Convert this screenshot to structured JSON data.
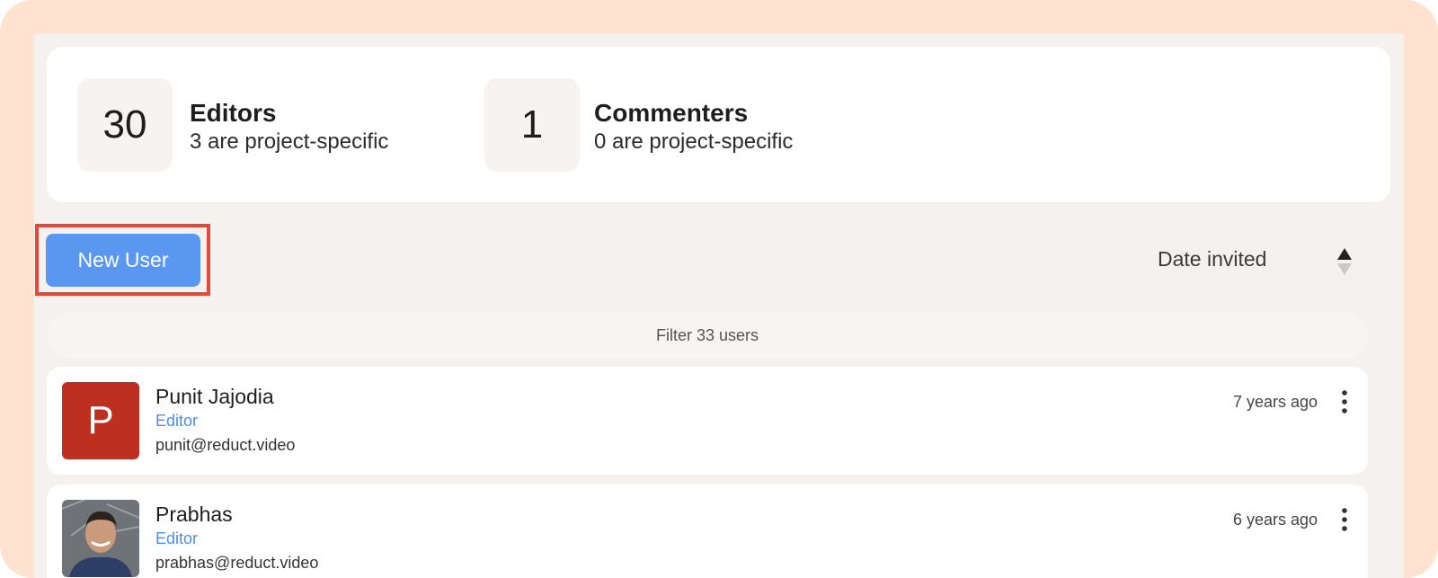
{
  "stats": [
    {
      "count": "30",
      "title": "Editors",
      "subtitle": "3 are project-specific"
    },
    {
      "count": "1",
      "title": "Commenters",
      "subtitle": "0 are project-specific"
    }
  ],
  "toolbar": {
    "new_user_label": "New User",
    "sort_label": "Date invited"
  },
  "filter": {
    "placeholder": "Filter 33 users"
  },
  "users": [
    {
      "avatar_letter": "P",
      "avatar_color": "#bd2f1e",
      "name": "Punit Jajodia",
      "role": "Editor",
      "email": "punit@reduct.video",
      "invited": "7 years ago"
    },
    {
      "avatar_letter": "",
      "avatar_icon": "profile-photo",
      "name": "Prabhas",
      "role": "Editor",
      "email": "prabhas@reduct.video",
      "invited": "6 years ago"
    }
  ],
  "colors": {
    "accent": "#5a97f0",
    "role": "#4c8fe8",
    "highlight": "#e24a37",
    "frame": "#ffe3d0"
  }
}
